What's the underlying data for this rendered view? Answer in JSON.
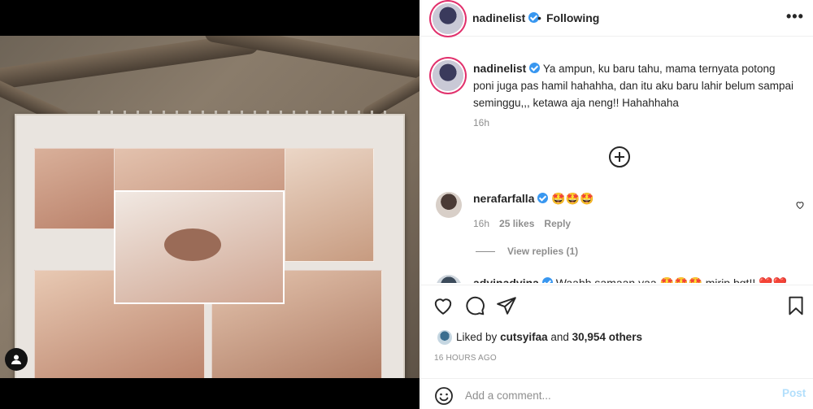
{
  "post": {
    "username": "nadinelist",
    "follow_status": "Following",
    "more_label": "•••",
    "separator": "•",
    "caption": "Ya ampun, ku baru tahu, mama ternyata potong poni juga pas hamil hahahha, dan itu aku baru lahir belum sampai seminggu,,, ketawa aja neng!! Hahahhaha",
    "caption_time": "16h"
  },
  "comments": [
    {
      "username": "nerafarfalla",
      "text": "🤩🤩🤩",
      "time": "16h",
      "likes": "25 likes",
      "reply_label": "Reply",
      "view_replies": "View replies (1)"
    },
    {
      "username": "adyinadvina",
      "text": "Waahh samaan yaa 🤩🤩🤩 mirip bgt!! ❤️❤️"
    }
  ],
  "likes": {
    "liked_by_prefix": "Liked by",
    "liked_by_user": "cutsyifaa",
    "and_label": "and",
    "others_count": "30,954 others"
  },
  "post_date": "16 HOURS AGO",
  "add_comment": {
    "placeholder": "Add a comment...",
    "post_label": "Post"
  },
  "icons": {
    "like": "heart-icon",
    "comment": "comment-icon",
    "share": "paper-plane-icon",
    "save": "bookmark-icon",
    "emoji": "smiley-icon",
    "tags": "user-tag-icon"
  },
  "colors": {
    "link_blue": "#3897f0",
    "post_button_disabled": "#b2dffc",
    "muted_text": "#8e8e8e"
  }
}
